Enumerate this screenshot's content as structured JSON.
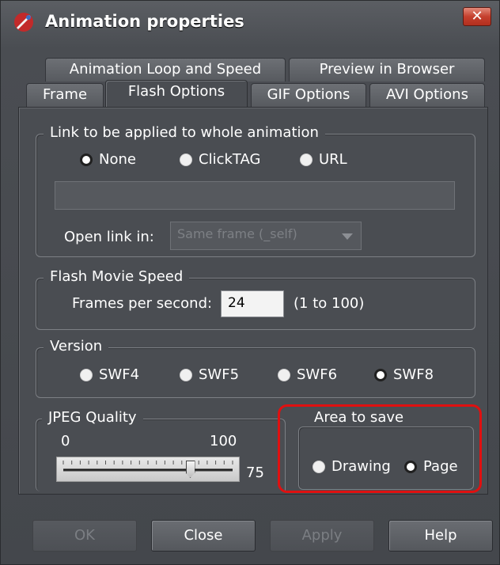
{
  "window": {
    "title": "Animation properties",
    "close_glyph": "✕"
  },
  "tabs": {
    "row1": [
      "Animation Loop and Speed",
      "Preview in Browser"
    ],
    "row2": [
      "Frame",
      "Flash Options",
      "GIF Options",
      "AVI Options"
    ],
    "active": "Flash Options"
  },
  "link_group": {
    "label": "Link to be applied to whole animation",
    "options": [
      "None",
      "ClickTAG",
      "URL"
    ],
    "selected": "None",
    "url_value": "",
    "open_link_label": "Open link in:",
    "open_link_value": "Same frame (_self)"
  },
  "speed_group": {
    "label": "Flash Movie Speed",
    "fps_label": "Frames per second:",
    "fps_value": "24",
    "range_hint": "(1 to 100)"
  },
  "version_group": {
    "label": "Version",
    "options": [
      "SWF4",
      "SWF5",
      "SWF6",
      "SWF8"
    ],
    "selected": "SWF8"
  },
  "jpeg_group": {
    "label": "JPEG Quality",
    "min_label": "0",
    "max_label": "100",
    "value": 75,
    "value_label": "75"
  },
  "area_group": {
    "label": "Area to save",
    "options": [
      "Drawing",
      "Page"
    ],
    "selected": "Page"
  },
  "buttons": {
    "ok": "OK",
    "close": "Close",
    "apply": "Apply",
    "help": "Help"
  },
  "colors": {
    "dialog_bg": "#4a4d52",
    "highlight": "#e01010"
  }
}
